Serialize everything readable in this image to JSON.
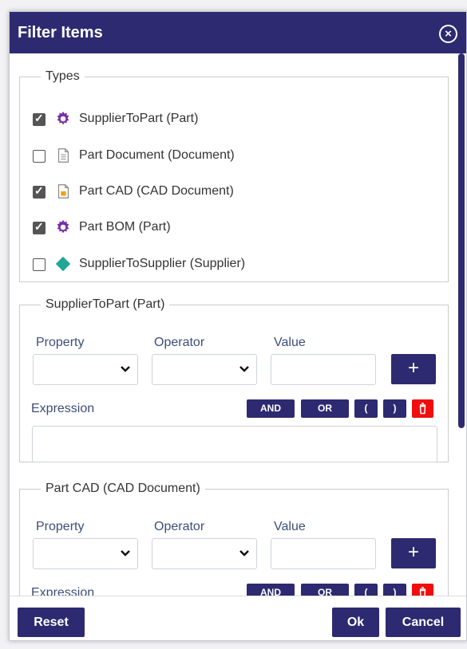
{
  "dialog": {
    "title": "Filter Items"
  },
  "types": {
    "legend": "Types",
    "items": [
      {
        "label": "SupplierToPart (Part)",
        "checked": true,
        "icon": "gear-icon"
      },
      {
        "label": "Part Document (Document)",
        "checked": false,
        "icon": "document-icon"
      },
      {
        "label": "Part CAD (CAD Document)",
        "checked": true,
        "icon": "cad-document-icon"
      },
      {
        "label": "Part BOM (Part)",
        "checked": true,
        "icon": "gear-icon"
      },
      {
        "label": "SupplierToSupplier (Supplier)",
        "checked": false,
        "icon": "diamond-icon"
      }
    ]
  },
  "filters": [
    {
      "legend": "SupplierToPart (Part)",
      "property_label": "Property",
      "operator_label": "Operator",
      "value_label": "Value",
      "add_label": "+",
      "expression_label": "Expression",
      "and_label": "AND",
      "or_label": "OR",
      "open_paren": "(",
      "close_paren": ")"
    },
    {
      "legend": "Part CAD (CAD Document)",
      "property_label": "Property",
      "operator_label": "Operator",
      "value_label": "Value",
      "add_label": "+",
      "expression_label": "Expression",
      "and_label": "AND",
      "or_label": "OR",
      "open_paren": "(",
      "close_paren": ")"
    }
  ],
  "footer": {
    "reset_label": "Reset",
    "ok_label": "Ok",
    "cancel_label": "Cancel"
  },
  "colors": {
    "header": "#2d2a71",
    "button": "#2d2a71",
    "delete": "#f10d0d",
    "gear": "#7a2aa8",
    "diamond": "#22a59a"
  }
}
